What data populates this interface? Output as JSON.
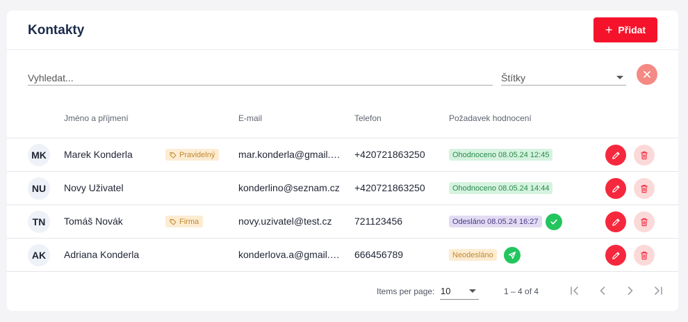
{
  "header": {
    "title": "Kontakty",
    "add_label": "Přidat"
  },
  "filters": {
    "search_placeholder": "Vyhledat...",
    "tags_label": "Štítky"
  },
  "table": {
    "columns": [
      "Jméno a příjmení",
      "E-mail",
      "Telefon",
      "Požadavek hodnocení"
    ],
    "rows": [
      {
        "initials": "MK",
        "name": "Marek Konderla",
        "tag": "Pravidelný",
        "email": "mar.konderla@gmail.com",
        "phone": "+420721863250",
        "status": "Ohodnoceno 08.05.24 12:45",
        "status_type": "rated"
      },
      {
        "initials": "NU",
        "name": "Novy Uživatel",
        "tag": "",
        "email": "konderlino@seznam.cz",
        "phone": "+420721863250",
        "status": "Ohodnoceno 08.05.24 14:44",
        "status_type": "rated"
      },
      {
        "initials": "TN",
        "name": "Tomáš Novák",
        "tag": "Firma",
        "email": "novy.uzivatel@test.cz",
        "phone": "721123456",
        "status": "Odesláno 08.05.24 16:27",
        "status_type": "sent",
        "status_icon": "check-icon"
      },
      {
        "initials": "AK",
        "name": "Adriana Konderla",
        "tag": "",
        "email": "konderlova.a@gmail.com",
        "phone": "666456789",
        "status": "Neodesláno",
        "status_type": "not-sent",
        "status_icon": "send-icon"
      }
    ]
  },
  "pagination": {
    "items_per_page_label": "Items per page:",
    "items_per_page": "10",
    "range": "1 – 4 of 4"
  },
  "colors": {
    "accent": "#f5132b",
    "rated": "#d5f3df",
    "sent": "#e2dcf3",
    "not_sent": "#fcecd2",
    "success": "#23c55e"
  }
}
